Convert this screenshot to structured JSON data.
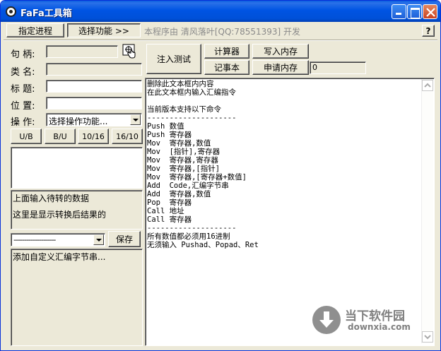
{
  "window": {
    "title": "FaFa工具箱"
  },
  "toolbar": {
    "assign_process": "指定进程",
    "select_function": "选择功能 >>",
    "info": "本程序由 清风落叶[QQ:78551393] 开发",
    "help": "?"
  },
  "fields": {
    "handle_label": "句 柄:",
    "classname_label": "类 名:",
    "title_label": "标 题:",
    "position_label": "位 置:",
    "operation_label": "操 作:",
    "operation_value": "选择操作功能..."
  },
  "convert_buttons": [
    "U/B",
    "B/U",
    "10/16",
    "16/10"
  ],
  "convert": {
    "hint_top": "上面输入待转的数据",
    "result": "这里是显示转换后结果的"
  },
  "custom": {
    "combo_value": "--------------------",
    "save": "保存",
    "hint": "添加自定义汇编字节串..."
  },
  "actions": {
    "inject": "注入测试",
    "calculator": "计算器",
    "write_memory": "写入内存",
    "notepad": "记事本",
    "alloc_memory": "申请内存",
    "alloc_value": "0"
  },
  "editor": {
    "lines": [
      "删除此文本框内内容",
      "在此文本框内输入汇编指令",
      "",
      "当前版本支持以下命令",
      "--------------------",
      "Push 数值",
      "Push 寄存器",
      "Mov  寄存器,数值",
      "Mov  [指针],寄存器",
      "Mov  寄存器,寄存器",
      "Mov  寄存器,[指针]",
      "Mov  寄存器,[寄存器+数值]",
      "Add  Code,汇编字节串",
      "Add  寄存器,数值",
      "Pop  寄存器",
      "Call 地址",
      "Call 寄存器",
      "--------------------",
      "所有数值都必须用16进制",
      "无须输入 Pushad、Popad、Ret"
    ]
  },
  "watermark": {
    "brand": "当下软件园",
    "url": "downxia.com"
  },
  "colors": {
    "titlebar": "#0054e3",
    "face": "#ece9d8",
    "close": "#c94222"
  }
}
